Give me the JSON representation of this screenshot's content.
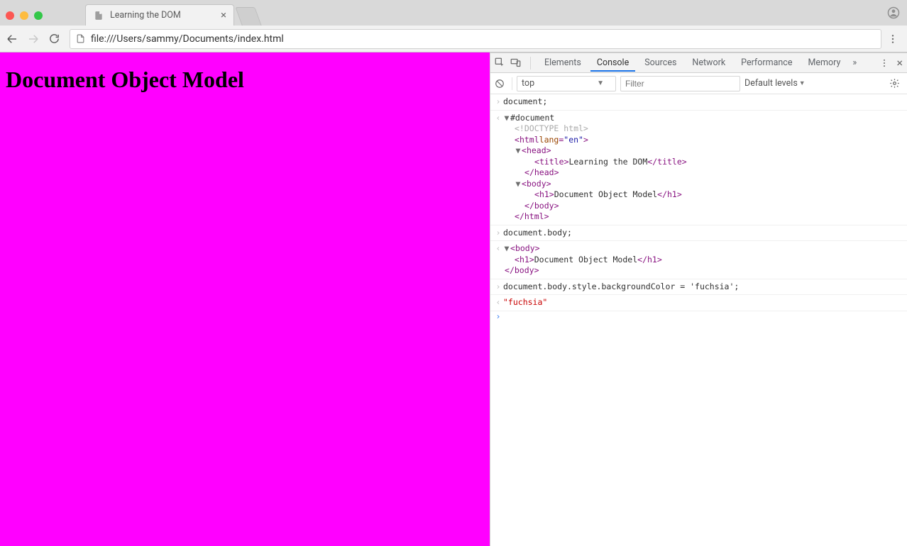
{
  "chrome": {
    "tab_title": "Learning the DOM",
    "url": "file:///Users/sammy/Documents/index.html"
  },
  "page": {
    "heading": "Document Object Model",
    "bg_color": "#ff00ff"
  },
  "devtools": {
    "tabs": {
      "elements": "Elements",
      "console": "Console",
      "sources": "Sources",
      "network": "Network",
      "performance": "Performance",
      "memory": "Memory"
    },
    "subbar": {
      "context": "top",
      "filter_placeholder": "Filter",
      "levels": "Default levels"
    },
    "console": {
      "cmd1": "document;",
      "out1": {
        "docroot": "#document",
        "doctype": "<!DOCTYPE html>",
        "html_open_tag": "html",
        "html_attr_name": "lang",
        "html_attr_eq": "=",
        "html_attr_val": "\"en\"",
        "head_open": "head",
        "title_open": "title",
        "title_text": "Learning the DOM",
        "title_close": "/title",
        "head_close": "/head",
        "body_open": "body",
        "h1_open": "h1",
        "h1_text": "Document Object Model",
        "h1_close": "/h1",
        "body_close": "/body",
        "html_close": "/html"
      },
      "cmd2": "document.body;",
      "out2": {
        "body_open": "body",
        "h1_open": "h1",
        "h1_text": "Document Object Model",
        "h1_close": "/h1",
        "body_close": "/body"
      },
      "cmd3": "document.body.style.backgroundColor = 'fuchsia';",
      "out3": "\"fuchsia\""
    }
  }
}
